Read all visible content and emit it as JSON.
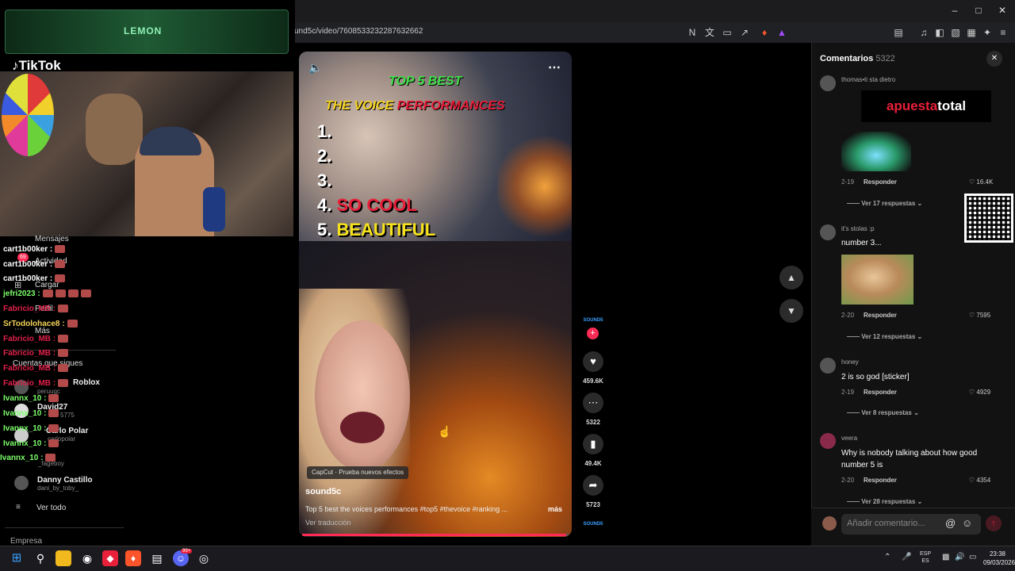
{
  "browser": {
    "url": "und5c/video/7608533232287632662"
  },
  "overlay": {
    "lemon": "LEMON",
    "tiktok": "TikTok",
    "chat": [
      {
        "user": "cart1b00ker :",
        "color": "#ffffff"
      },
      {
        "user": "cart1b00ker :",
        "color": "#ffffff"
      },
      {
        "user": "cart1b00ker :",
        "color": "#ffffff"
      },
      {
        "user": "jefri2023 :",
        "color": "#7cff6a"
      },
      {
        "user": "Fabricio_MB :",
        "color": "#e0204a"
      },
      {
        "user": "SrTodolohace8 :",
        "color": "#f5d45a"
      },
      {
        "user": "Fabricio_MB :",
        "color": "#e0204a"
      },
      {
        "user": "Fabricio_MB :",
        "color": "#e0204a"
      },
      {
        "user": "Fabricio_MB :",
        "color": "#e0204a"
      },
      {
        "user": "Fabricio_MB :",
        "color": "#e0204a"
      },
      {
        "user": "Ivannx_10 :",
        "color": "#7cff6a"
      },
      {
        "user": "Ivannx_10 :",
        "color": "#7cff6a"
      },
      {
        "user": "Ivannx_10 :",
        "color": "#7cff6a"
      },
      {
        "user": "Ivannx_10 :",
        "color": "#7cff6a"
      },
      {
        "user": "Ivannx_10 :",
        "color": "#7cff6a"
      }
    ],
    "nav": {
      "mensajes": "Mensajes",
      "actividad": "Actividad",
      "cargar": "Cargar",
      "perfil": "Perfil",
      "mas": "Más",
      "cuentas": "Cuentas que sigues",
      "badge": "69"
    },
    "accounts": [
      {
        "name": "Roblox",
        "sub": "peruugc"
      },
      {
        "name": "David27",
        "sub": "5775"
      },
      {
        "name": "Carlo Polar",
        "sub": "carlopolar"
      },
      {
        "name": "",
        "sub": "_fageboy"
      },
      {
        "name": "Danny Castillo",
        "sub": "dani_by_toby_"
      }
    ],
    "ver_todo": "Ver todo",
    "empresa": "Empresa"
  },
  "video": {
    "title_line1": "TOP 5 BEST",
    "title_line2a": "THE VOICE",
    "title_line2b": "PERFORMANCES",
    "ranks": {
      "r1": "1.",
      "r2": "2.",
      "r3": "3.",
      "r4num": "4.",
      "r4text": "SO COOL",
      "r5num": "5.",
      "r5text": "BEAUTIFUL"
    },
    "capcut": "CapCut · Prueba nuevos efectos",
    "author": "sound5c",
    "caption": "Top 5 best the voices performances #top5 #thevoice #ranking ...",
    "more": "más",
    "translate": "Ver traducción",
    "progress": 0.99
  },
  "actions": {
    "likes": "459.6K",
    "comments": "5322",
    "saves": "49.4K",
    "shares": "5723"
  },
  "comments": {
    "title": "Comentarios",
    "count": "5322",
    "ad_a": "apuesta",
    "ad_b": "total",
    "input_placeholder": "Añadir comentario...",
    "items": [
      {
        "user": "thomas•ti sta dietro",
        "text": "",
        "date": "2-19",
        "reply": "Responder",
        "likes": "16.4K",
        "replies": "Ver 17 respuestas"
      },
      {
        "user": "it's stolas :p",
        "text": "number 3...",
        "date": "2-20",
        "reply": "Responder",
        "likes": "7595",
        "replies": "Ver 12 respuestas"
      },
      {
        "user": "honey",
        "text": "2 is so god [sticker]",
        "date": "2-19",
        "reply": "Responder",
        "likes": "4929",
        "replies": "Ver 8 respuestas"
      },
      {
        "user": "veera",
        "text": "Why is nobody talking about how good",
        "text2": "number 5 is",
        "date": "2-20",
        "reply": "Responder",
        "likes": "4354",
        "replies": "Ver 28 respuestas"
      }
    ]
  },
  "taskbar": {
    "lang1": "ESP",
    "lang2": "ES",
    "time": "23:38",
    "date": "09/03/2026",
    "notif": "99+"
  }
}
